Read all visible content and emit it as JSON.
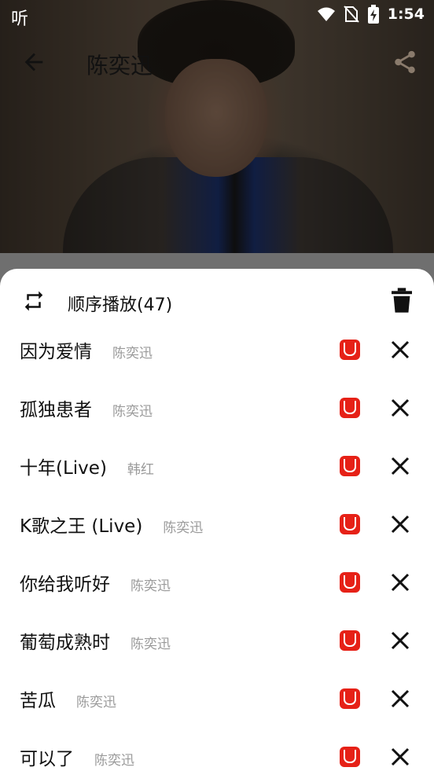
{
  "status_bar": {
    "app_glyph": "听",
    "time": "1:54"
  },
  "app_bar": {
    "title": "陈奕迅"
  },
  "playlist": {
    "mode_label": "顺序播放(47)",
    "items": [
      {
        "song": "因为爱情",
        "artist": "陈奕迅"
      },
      {
        "song": "孤独患者",
        "artist": "陈奕迅"
      },
      {
        "song": "十年(Live)",
        "artist": "韩红"
      },
      {
        "song": "K歌之王 (Live)",
        "artist": "陈奕迅"
      },
      {
        "song": "你给我听好",
        "artist": "陈奕迅"
      },
      {
        "song": "葡萄成熟时",
        "artist": "陈奕迅"
      },
      {
        "song": "苦瓜",
        "artist": "陈奕迅"
      },
      {
        "song": "可以了",
        "artist": "陈奕迅"
      }
    ]
  },
  "colors": {
    "badge": "#e62117",
    "sheet_background": "#ffffff",
    "artist_text": "#9a9a9a"
  },
  "icons": {
    "back": "arrow-back-icon",
    "share": "share-icon",
    "mode": "repeat-icon",
    "delete": "trash-icon",
    "quality": "u-badge-icon",
    "remove": "close-icon"
  }
}
